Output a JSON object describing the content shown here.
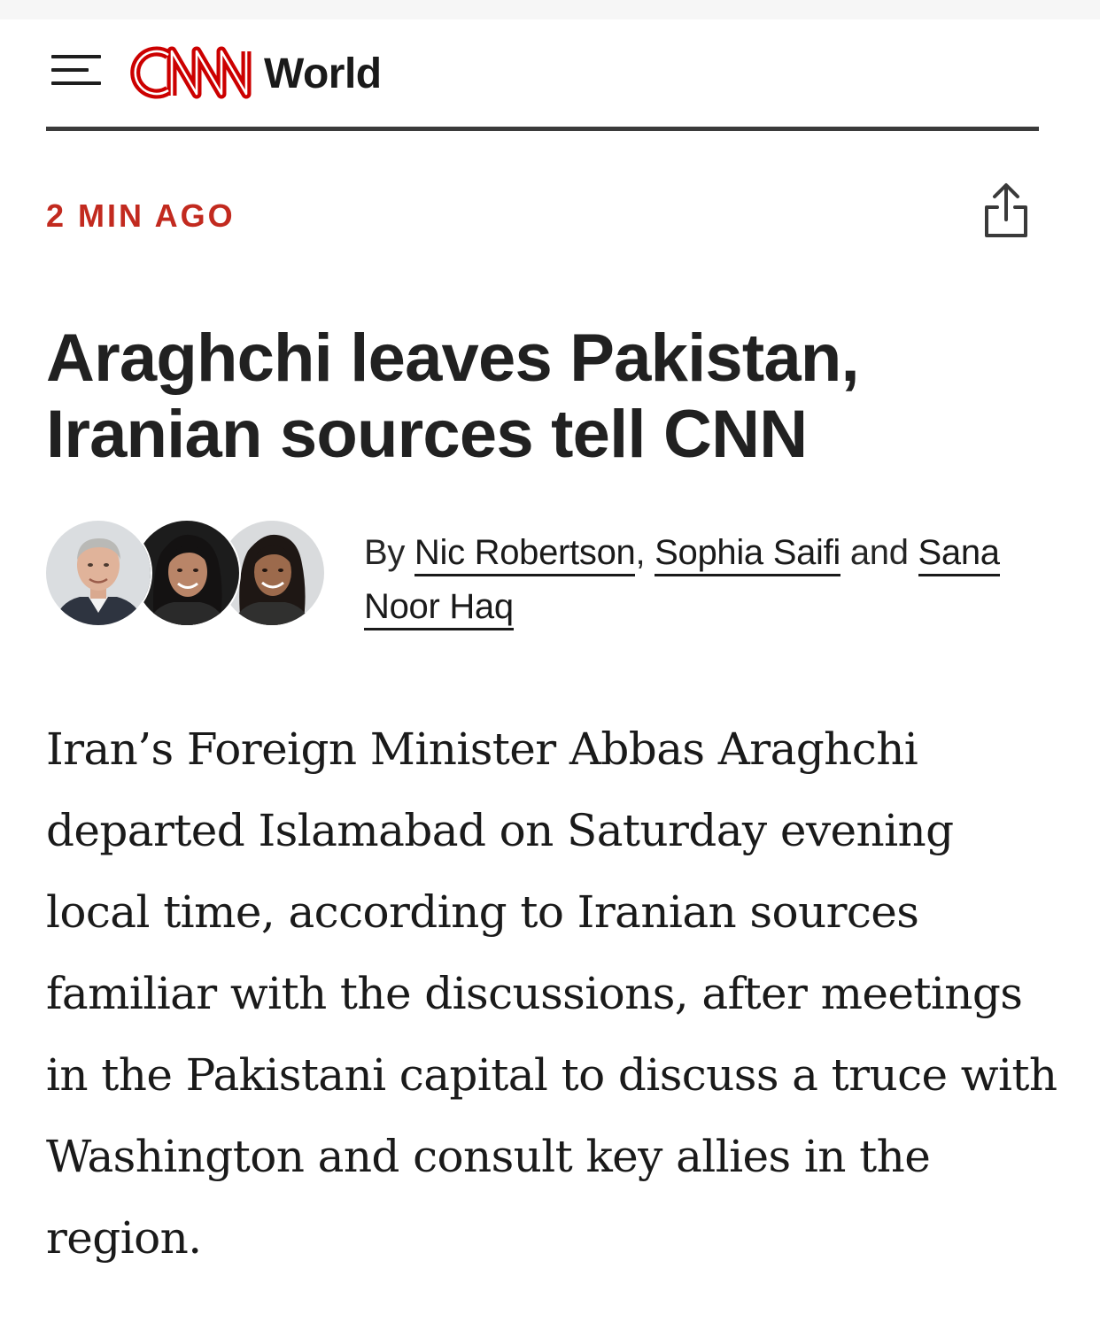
{
  "header": {
    "menu_icon": "hamburger-menu-icon",
    "logo_text": "CNN",
    "section": "World"
  },
  "article": {
    "timestamp": "2 MIN AGO",
    "share_icon": "share-icon",
    "headline": "Araghchi leaves Pakistan, Iranian sources tell CNN",
    "byline": {
      "prefix": "By",
      "authors": [
        "Nic Robertson",
        "Sophia Saifi",
        "Sana Noor Haq"
      ],
      "separator": ",",
      "conjunction": "and"
    },
    "body": "Iran’s Foreign Minister Abbas Araghchi departed Islamabad on Saturday evening local time, according to Iranian sources familiar with the discussions, after meetings in the Pakistani capital to discuss a truce with Washington and consult key allies in the region."
  },
  "colors": {
    "brand_red": "#cc0000",
    "timestamp_red": "#c22a1f",
    "text": "#1a1a1a",
    "rule": "#3b3b3b"
  }
}
